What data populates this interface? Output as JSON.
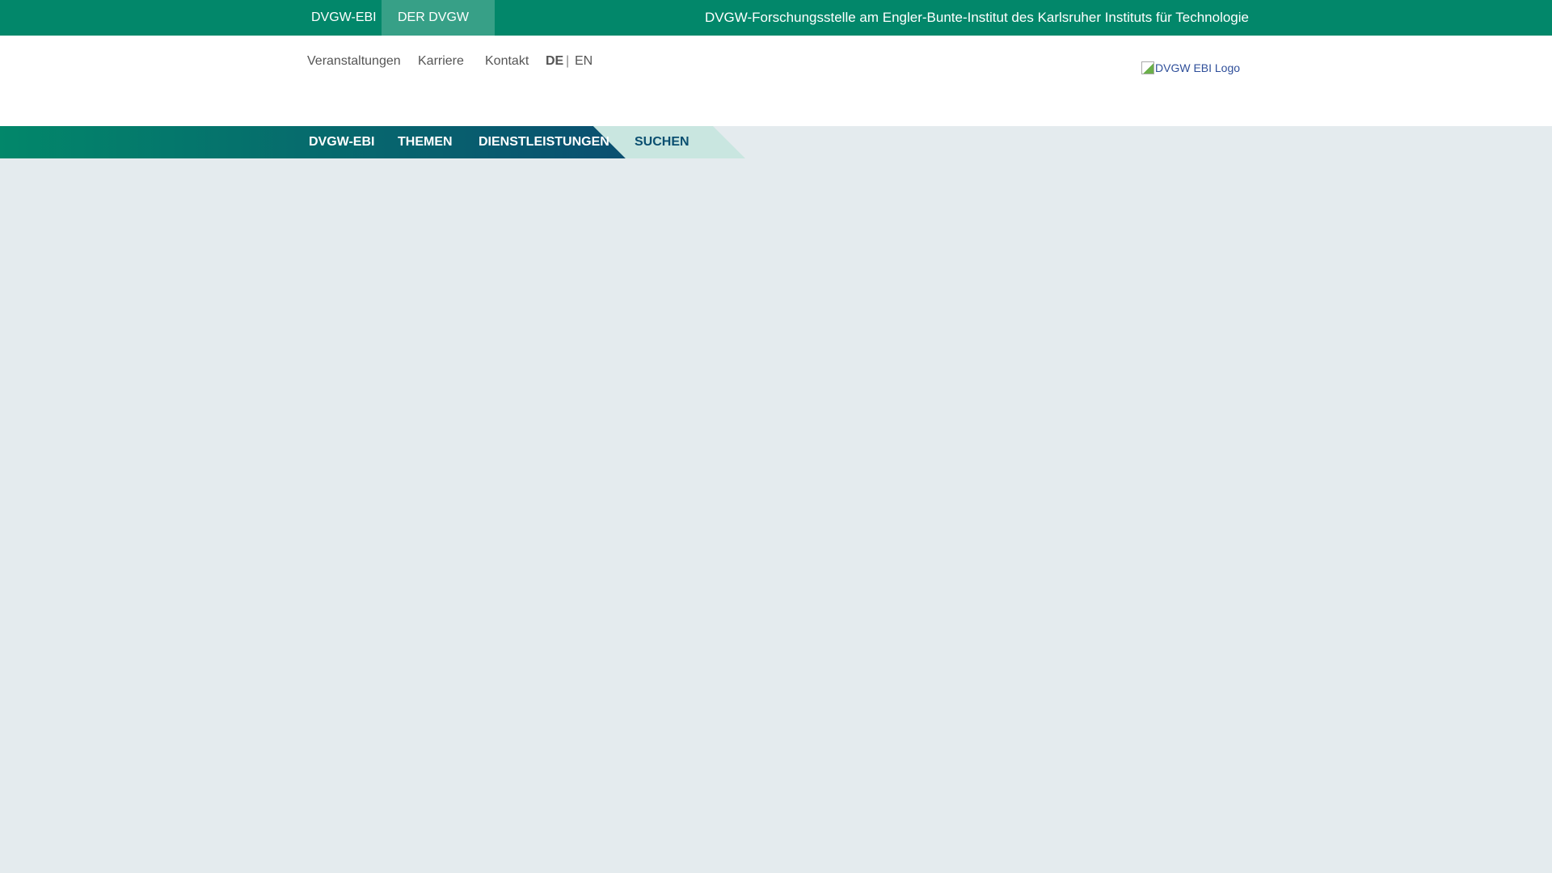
{
  "topbar": {
    "tab1": "DVGW-EBI",
    "tab2": "DER DVGW",
    "title": "DVGW-Forschungsstelle am Engler-Bunte-Institut des Karlsruher Instituts für Technologie"
  },
  "meta": {
    "events": "Veranstaltungen",
    "career": "Karriere",
    "contact": "Kontakt",
    "lang_de": "DE",
    "sep": "|",
    "lang_en": "EN"
  },
  "logo": {
    "alt": "DVGW EBI Logo"
  },
  "nav": {
    "items": [
      "DVGW-EBI",
      "THEMEN",
      "DIENSTLEISTUNGEN"
    ],
    "search": "SUCHEN"
  },
  "colors": {
    "brand": "#02876a",
    "dark": "#0a4f70",
    "light": "#c9e6e0"
  }
}
